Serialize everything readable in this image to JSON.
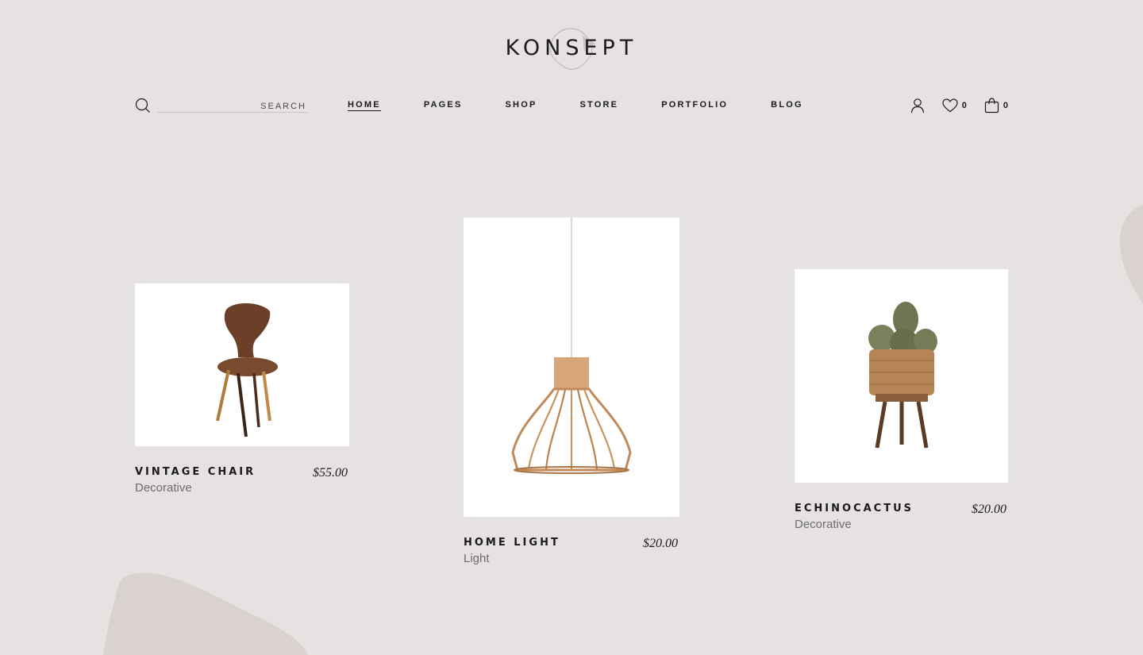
{
  "brand": {
    "name": "KONSEPT"
  },
  "search": {
    "placeholder": "SEARCH"
  },
  "nav": [
    {
      "label": "HOME",
      "active": true
    },
    {
      "label": "PAGES",
      "active": false
    },
    {
      "label": "SHOP",
      "active": false
    },
    {
      "label": "STORE",
      "active": false
    },
    {
      "label": "PORTFOLIO",
      "active": false
    },
    {
      "label": "BLOG",
      "active": false
    }
  ],
  "header_actions": {
    "wishlist_count": "0",
    "cart_count": "0"
  },
  "products": [
    {
      "name": "VINTAGE CHAIR",
      "category": "Decorative",
      "price": "$55.00"
    },
    {
      "name": "HOME LIGHT",
      "category": "Light",
      "price": "$20.00"
    },
    {
      "name": "ECHINOCACTUS",
      "category": "Decorative",
      "price": "$20.00"
    }
  ],
  "colors": {
    "background": "#e6e2e1",
    "blob": "#dad2ce",
    "text": "#1a1a1a",
    "muted": "#6d6d6d"
  },
  "icons": [
    "search-icon",
    "user-icon",
    "heart-icon",
    "cart-icon"
  ]
}
